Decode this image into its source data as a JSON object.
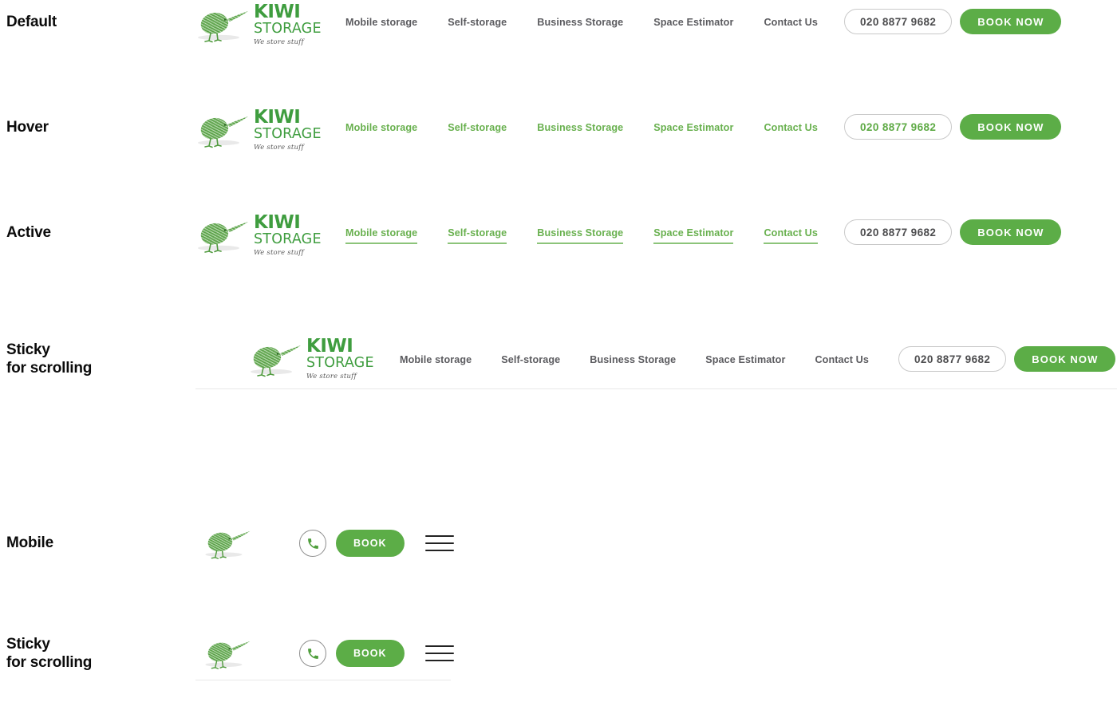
{
  "page": {
    "background": "#ffffff",
    "brand_green": "#5cad47",
    "link_green": "#68b04e",
    "text_gray": "#5b5b5f"
  },
  "states": [
    {
      "label": "Default"
    },
    {
      "label": "Hover"
    },
    {
      "label": "Active"
    },
    {
      "label": "Sticky\nfor scrolling"
    },
    {
      "label": "Mobile"
    },
    {
      "label": "Sticky\nfor scrolling"
    }
  ],
  "logo": {
    "icon": "kiwi-bird-icon",
    "title": "KIWI",
    "subtitle": "STORAGE",
    "tagline": "We store stuff"
  },
  "nav": {
    "items": [
      {
        "label": "Mobile storage"
      },
      {
        "label": "Self-storage"
      },
      {
        "label": "Business Storage"
      },
      {
        "label": "Space Estimator"
      },
      {
        "label": "Contact Us"
      }
    ]
  },
  "actions": {
    "phone_label": "020 8877 9682",
    "book_label": "BOOK NOW",
    "book_label_mobile": "BOOK",
    "phone_icon": "phone-icon",
    "menu_icon": "hamburger-menu-icon"
  }
}
